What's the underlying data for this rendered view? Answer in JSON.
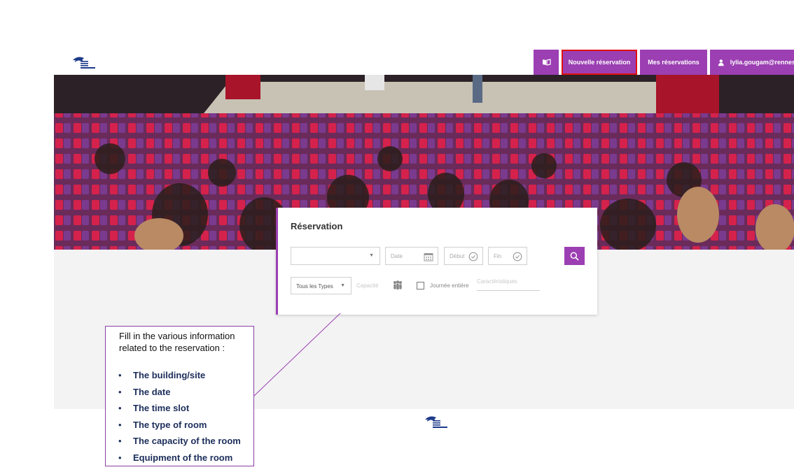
{
  "nav": {
    "book_icon": "book-open-icon",
    "new_reservation": "Nouvelle réservation",
    "my_reservations": "Mes réservations",
    "user_email": "lylia.gougam@rennes-s",
    "user_icon": "user-icon"
  },
  "colors": {
    "accent": "#9b3fb2",
    "highlight": "#e01010",
    "note_text": "#1b2d5a"
  },
  "reservation": {
    "title": "Réservation",
    "site_value": "",
    "date_placeholder": "Date",
    "start_placeholder": "Début",
    "end_placeholder": "Fin",
    "type_value": "Tous les Types",
    "capacity_placeholder": "Capacité",
    "full_day_label": "Journée entière",
    "features_placeholder": "Caractéristiques"
  },
  "note": {
    "intro": "Fill in the various information related to the reservation :",
    "items": [
      "The building/site",
      "The date",
      "The time slot",
      "The type of room",
      "The capacity of the room",
      "Equipment of the room"
    ]
  }
}
